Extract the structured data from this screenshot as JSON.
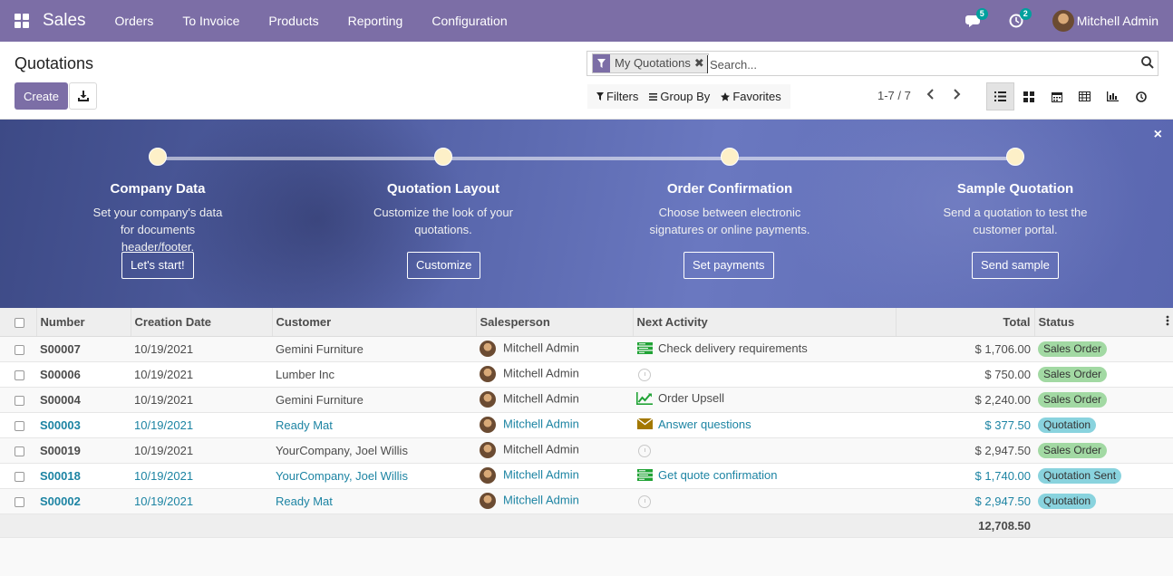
{
  "navbar": {
    "brand": "Sales",
    "menu": [
      "Orders",
      "To Invoice",
      "Products",
      "Reporting",
      "Configuration"
    ],
    "messages_count": "5",
    "activities_count": "2",
    "user_name": "Mitchell Admin"
  },
  "control_panel": {
    "title": "Quotations",
    "create_label": "Create",
    "facet_label": "My Quotations",
    "facet_close": "✖",
    "search_placeholder": "Search...",
    "filters_label": "Filters",
    "groupby_label": "Group By",
    "favorites_label": "Favorites",
    "pager": "1-7 / 7"
  },
  "banner": {
    "close": "×",
    "steps": [
      {
        "title": "Company Data",
        "desc": "Set your company's data for documents header/footer.",
        "button": "Let's start!"
      },
      {
        "title": "Quotation Layout",
        "desc": "Customize the look of your quotations.",
        "button": "Customize"
      },
      {
        "title": "Order Confirmation",
        "desc": "Choose between electronic signatures or online payments.",
        "button": "Set payments"
      },
      {
        "title": "Sample Quotation",
        "desc": "Send a quotation to test the customer portal.",
        "button": "Send sample"
      }
    ]
  },
  "table": {
    "headers": [
      "Number",
      "Creation Date",
      "Customer",
      "Salesperson",
      "Next Activity",
      "Total",
      "Status"
    ],
    "rows": [
      {
        "number": "S00007",
        "date": "10/19/2021",
        "customer": "Gemini Furniture",
        "salesperson": "Mitchell Admin",
        "activity": "Check delivery requirements",
        "activity_icon": "todo-list-icon",
        "total": "$ 1,706.00",
        "status": "Sales Order"
      },
      {
        "number": "S00006",
        "date": "10/19/2021",
        "customer": "Lumber Inc",
        "salesperson": "Mitchell Admin",
        "activity": "",
        "activity_icon": "clock-icon",
        "total": "$ 750.00",
        "status": "Sales Order"
      },
      {
        "number": "S00004",
        "date": "10/19/2021",
        "customer": "Gemini Furniture",
        "salesperson": "Mitchell Admin",
        "activity": "Order Upsell",
        "activity_icon": "trend-up-icon",
        "total": "$ 2,240.00",
        "status": "Sales Order"
      },
      {
        "number": "S00003",
        "date": "10/19/2021",
        "customer": "Ready Mat",
        "salesperson": "Mitchell Admin",
        "activity": "Answer questions",
        "activity_icon": "envelope-icon",
        "total": "$ 377.50",
        "status": "Quotation"
      },
      {
        "number": "S00019",
        "date": "10/19/2021",
        "customer": "YourCompany, Joel Willis",
        "salesperson": "Mitchell Admin",
        "activity": "",
        "activity_icon": "clock-icon",
        "total": "$ 2,947.50",
        "status": "Sales Order"
      },
      {
        "number": "S00018",
        "date": "10/19/2021",
        "customer": "YourCompany, Joel Willis",
        "salesperson": "Mitchell Admin",
        "activity": "Get quote confirmation",
        "activity_icon": "todo-list-icon",
        "total": "$ 1,740.00",
        "status": "Quotation Sent"
      },
      {
        "number": "S00002",
        "date": "10/19/2021",
        "customer": "Ready Mat",
        "salesperson": "Mitchell Admin",
        "activity": "",
        "activity_icon": "clock-icon",
        "total": "$ 2,947.50",
        "status": "Quotation"
      }
    ],
    "grand_total": "12,708.50"
  },
  "colors": {
    "brand": "#7c6ea6",
    "link_blue": "#1d84a3",
    "status_green": "#a2d9a3",
    "status_blue": "#89d3de",
    "activity_green": "#21a336",
    "activity_envelope": "#a37800"
  }
}
